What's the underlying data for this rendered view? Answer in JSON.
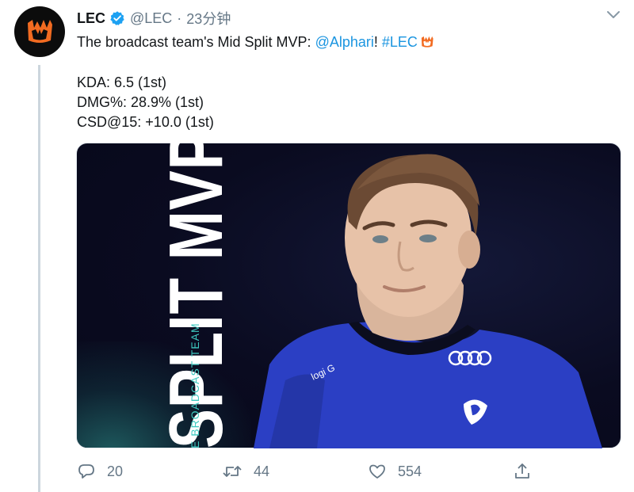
{
  "account": {
    "name": "LEC",
    "handle": "@LEC",
    "separator": "·",
    "time": "23分钟"
  },
  "tweet": {
    "text_before": "The broadcast team's Mid Split MVP: ",
    "mention": "@Alphari",
    "text_mid": "! ",
    "hashtag": "#LEC",
    "stats": [
      "KDA: 6.5 (1st)",
      "DMG%: 28.9% (1st)",
      "CSD@15: +10.0 (1st)"
    ]
  },
  "media": {
    "headline": "SPLIT MVP",
    "subline": "E BROADCAST TEAM"
  },
  "actions": {
    "replies": "20",
    "retweets": "44",
    "likes": "554"
  },
  "colors": {
    "link": "#1b95e0",
    "muted": "#657786",
    "verified": "#1da1f2",
    "brand_orange": "#f26b21"
  },
  "icons": [
    "lec-logo-icon",
    "verified-badge-icon",
    "chevron-down-icon",
    "reply-icon",
    "retweet-icon",
    "like-icon",
    "share-icon"
  ]
}
